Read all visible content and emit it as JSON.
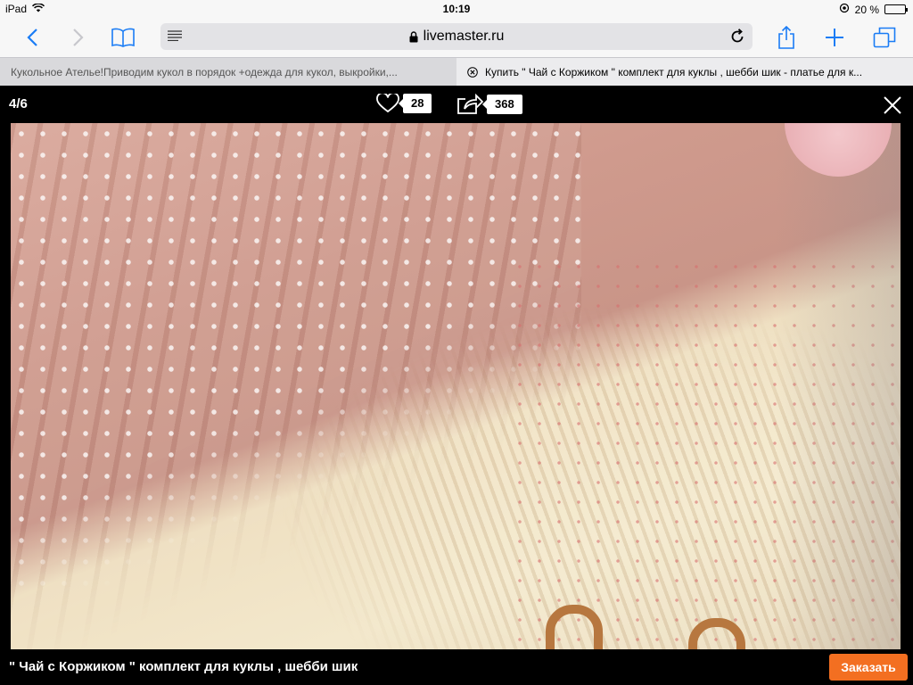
{
  "status": {
    "device": "iPad",
    "time": "10:19",
    "battery": "20 %",
    "battery_level": 0.2
  },
  "toolbar": {
    "url": "livemaster.ru"
  },
  "tabs": [
    {
      "title": "Кукольное Ателье!Приводим кукол в порядок +одежда для кукол, выкройки,..."
    },
    {
      "title": "Купить \" Чай с Коржиком \" комплект для куклы , шебби шик - платье для к..."
    }
  ],
  "viewer": {
    "counter": "4/6",
    "likes": "28",
    "shares": "368"
  },
  "product": {
    "title": "\" Чай с Коржиком \" комплект для куклы , шебби шик",
    "order_label": "Заказать"
  },
  "colors": {
    "accent": "#1a7cf5",
    "order_button": "#f36f21"
  }
}
